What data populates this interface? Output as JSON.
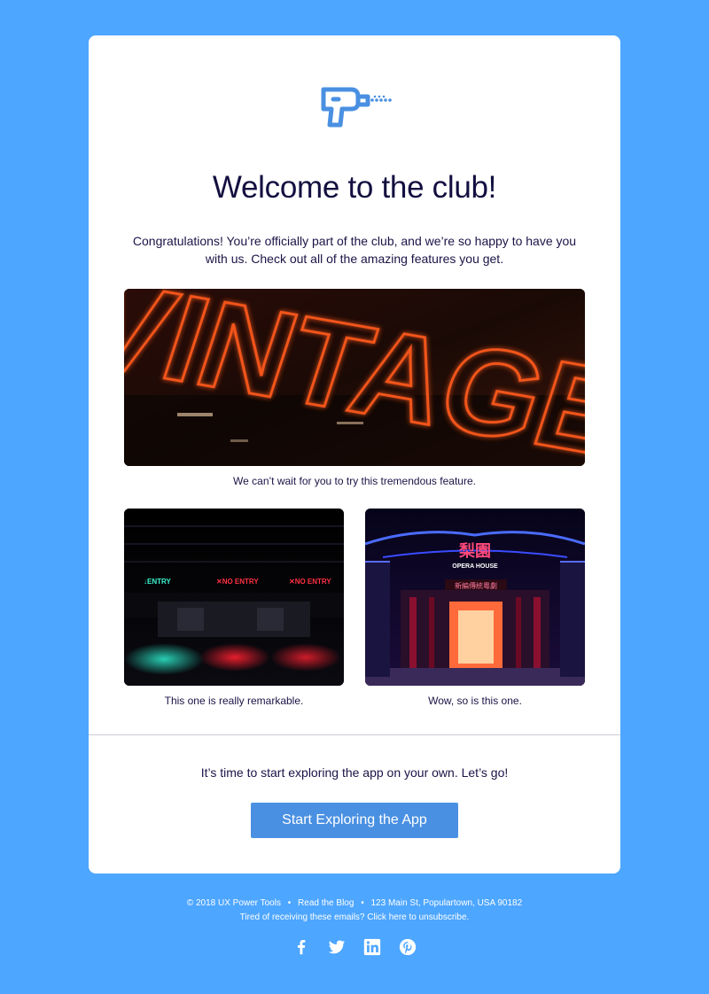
{
  "colors": {
    "background": "#4da6ff",
    "card": "#ffffff",
    "heading": "#130f40",
    "button": "#4a90e2",
    "logo": "#4a90e2"
  },
  "logo": {
    "icon": "drill-icon"
  },
  "header": {
    "title": "Welcome to the club!"
  },
  "intro": {
    "text": "Congratulations! You’re officially part of the club, and we’re so happy to have you with us. Check out all of the amazing features you get."
  },
  "features": {
    "hero": {
      "image": "neon-vintage-sign-photo",
      "sign_text": "VINTAGE",
      "caption": "We can’t wait for you to try this tremendous feature."
    },
    "left": {
      "image": "parking-entrance-neon-photo",
      "signs": [
        "↓ENTRY",
        "✕NO ENTRY",
        "✕NO ENTRY"
      ],
      "caption": "This one is really remarkable."
    },
    "right": {
      "image": "opera-house-neon-photo",
      "signs": [
        "梨園",
        "OPERA HOUSE",
        "新編傳統粵劇"
      ],
      "caption": "Wow, so is this one."
    }
  },
  "cta": {
    "text": "It’s time to start exploring the app on your own. Let’s go!",
    "button_label": "Start Exploring the App"
  },
  "footer": {
    "copyright": "© 2018 UX Power Tools",
    "blog_link": "Read the Blog",
    "address": "123 Main St, Populartown, USA 90182",
    "unsubscribe": "Tired of receiving these emails? Click here to unsubscribe.",
    "bullet": "•"
  },
  "social": [
    "facebook-icon",
    "twitter-icon",
    "linkedin-icon",
    "pinterest-icon"
  ]
}
